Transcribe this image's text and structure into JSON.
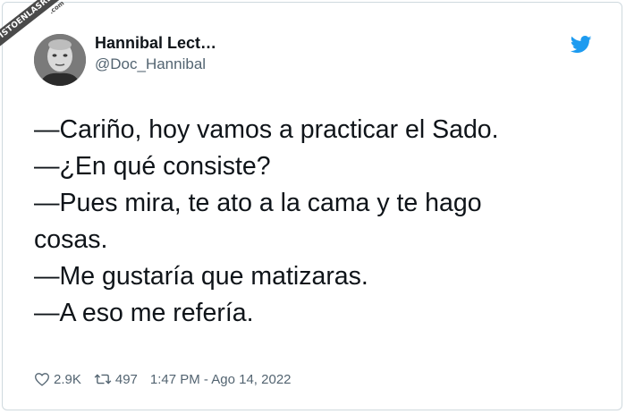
{
  "watermark": {
    "text": "VISTOENLASREDES",
    "sub": ".com"
  },
  "tweet": {
    "author_name": "Hannibal Lect…",
    "author_handle": "@Doc_Hannibal",
    "lines": [
      "—Cariño, hoy vamos a practicar el Sado.",
      "—¿En qué consiste?",
      "—Pues mira, te ato a la cama y te hago",
      "cosas.",
      "—Me gustaría que matizaras.",
      "—A eso me refería."
    ],
    "likes": "2.9K",
    "retweets": "497",
    "timestamp": "1:47 PM - Ago 14, 2022"
  },
  "icons": {
    "brand": "twitter-bird-icon",
    "like": "heart-icon",
    "retweet": "retweet-icon"
  },
  "colors": {
    "twitter_blue": "#1d9bf0",
    "text": "#0f1419",
    "muted": "#536471"
  }
}
